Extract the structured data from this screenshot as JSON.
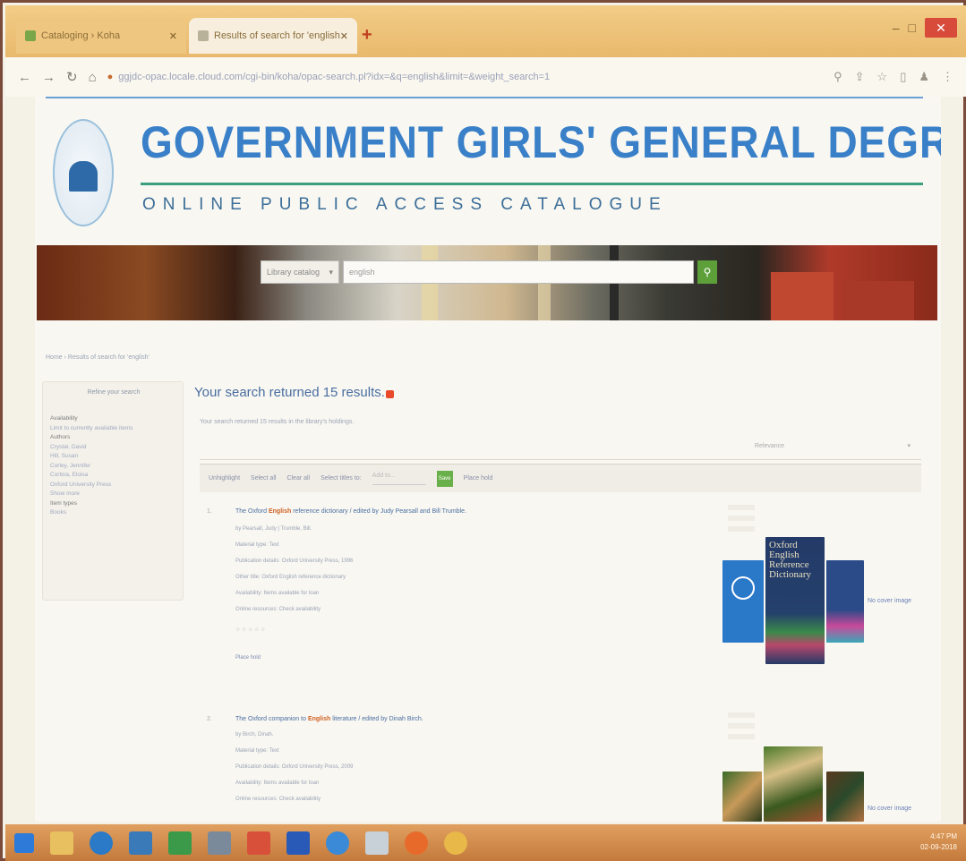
{
  "browser": {
    "tabs": [
      {
        "label": "Cataloging › Koha",
        "close": "✕"
      },
      {
        "label": "Results of search for 'english' ›",
        "close": "✕"
      }
    ],
    "new_tab": "+",
    "window_controls": {
      "minimize": "–",
      "maximize": "□",
      "close": "✕"
    },
    "url": "ggjdc-opac.locale.cloud.com/cgi-bin/koha/opac-search.pl?idx=&q=english&limit=&weight_search=1"
  },
  "site": {
    "college_name": "GOVERNMENT GIRLS' GENERAL DEGREE COLLEGE",
    "catalogue_title": "ONLINE PUBLIC ACCESS CATALOGUE"
  },
  "search": {
    "scope_label": "Library catalog",
    "query": "english",
    "button_icon": "search-icon"
  },
  "breadcrumb": "Home › Results of search for 'english'",
  "facets": {
    "title": "Refine your search",
    "items": [
      {
        "label": "Availability",
        "heading": true
      },
      {
        "label": "Limit to currently available items",
        "heading": false
      },
      {
        "label": "Authors",
        "heading": true
      },
      {
        "label": "Crystal, David",
        "heading": false
      },
      {
        "label": "Hill, Susan",
        "heading": false
      },
      {
        "label": "Corley, Jennifer",
        "heading": false
      },
      {
        "label": "Cortina, Eloisa",
        "heading": false
      },
      {
        "label": "Oxford University Press",
        "heading": false
      },
      {
        "label": "Show more",
        "heading": false
      },
      {
        "label": "Item types",
        "heading": true
      },
      {
        "label": "Books",
        "heading": false
      }
    ]
  },
  "results": {
    "heading": "Your search returned 15 results.",
    "subheading": "Your search returned 15 results in the library's holdings.",
    "sort_label": "Relevance",
    "toolbar": {
      "highlight": "Unhighlight",
      "select_all": "Select all",
      "clear_all": "Clear all",
      "select_titles": "Select titles to:",
      "action_select": "Add to...",
      "go": "Save",
      "place_hold": "Place hold"
    },
    "items": [
      {
        "number": "1.",
        "title_prefix": "The Oxford",
        "title_highlight": "English",
        "title_suffix": "reference dictionary / edited by Judy Pearsall and Bill Trumble.",
        "lines": [
          "by Pearsall, Judy | Trumble, Bill.",
          "Material type: Text",
          "Publication details: Oxford University Press, 1996",
          "Other title: Oxford English reference dictionary",
          "Availability: Items available for loan",
          "Online resources: Check availability"
        ],
        "tags_line": "Place hold",
        "cover_caption": "No cover image",
        "cover_titles": [
          "Oxford",
          "English",
          "Reference",
          "Dictionary"
        ]
      },
      {
        "number": "2.",
        "title_prefix": "The Oxford companion to",
        "title_highlight": "English",
        "title_suffix": "literature / edited by Dinah Birch.",
        "lines": [
          "by Birch, Dinah.",
          "Material type: Text",
          "Publication details: Oxford University Press, 2009",
          "Availability: Items available for loan",
          "Online resources: Check availability"
        ],
        "cover_caption": "No cover image"
      }
    ]
  },
  "taskbar": {
    "time": "4:47 PM",
    "date": "02-09-2018"
  }
}
